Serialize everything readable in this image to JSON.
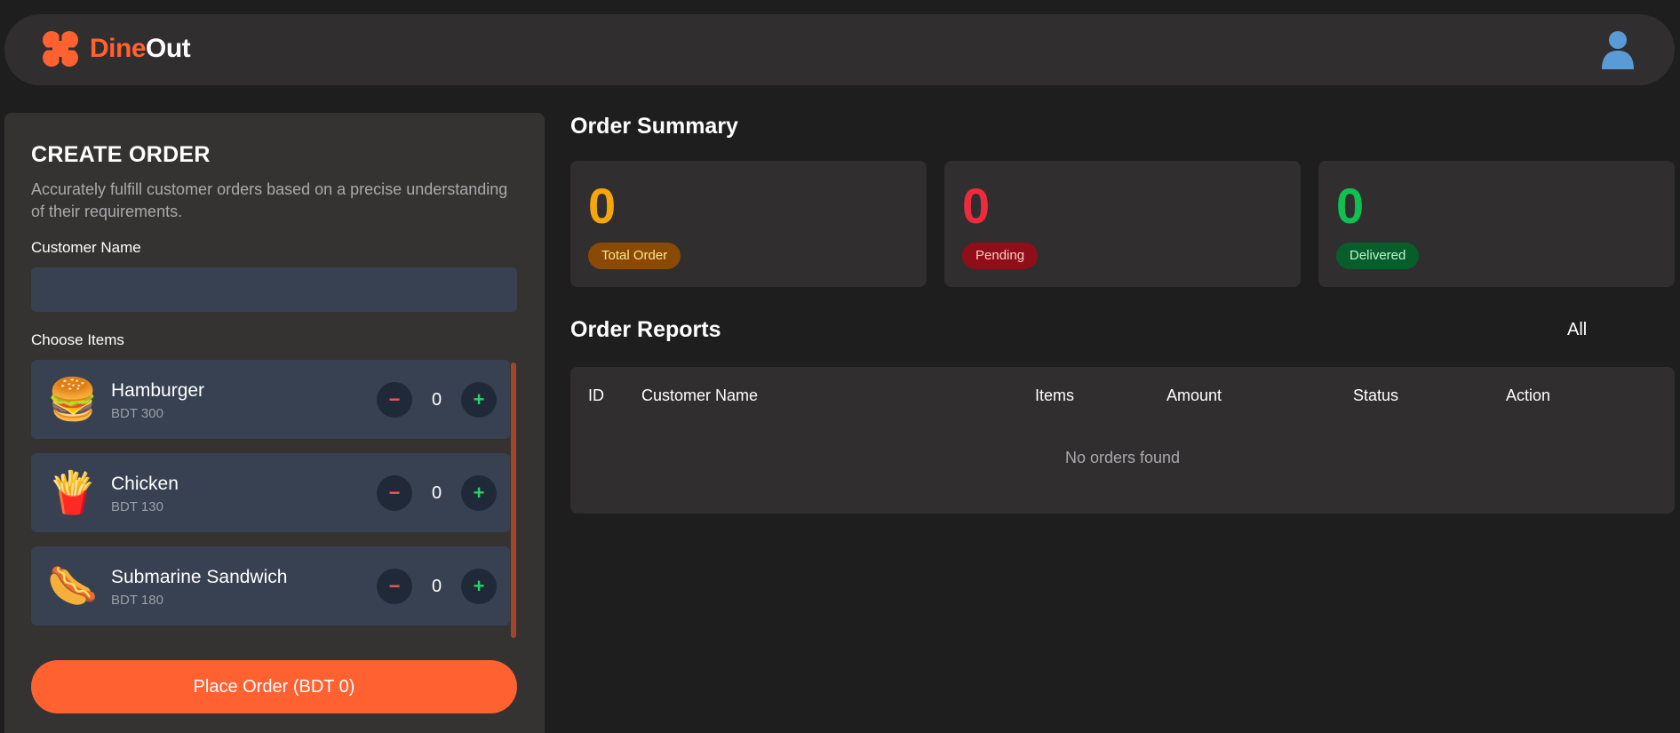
{
  "header": {
    "brand_part1": "Dine",
    "brand_part2": "Out",
    "logo_icon": "flower-icon",
    "avatar_icon": "user-icon"
  },
  "create_order": {
    "title": "CREATE ORDER",
    "description": "Accurately fulfill customer orders based on a precise understanding of their requirements.",
    "customer_name_label": "Customer Name",
    "customer_name_value": "",
    "choose_items_label": "Choose Items",
    "items": [
      {
        "name": "Hamburger",
        "price": "BDT 300",
        "qty": "0",
        "emoji": "🍔"
      },
      {
        "name": "Chicken",
        "price": "BDT 130",
        "qty": "0",
        "emoji": "🍟"
      },
      {
        "name": "Submarine Sandwich",
        "price": "BDT 180",
        "qty": "0",
        "emoji": "🌭"
      }
    ],
    "minus_symbol": "−",
    "plus_symbol": "+",
    "place_order_label": "Place Order (BDT 0)"
  },
  "summary": {
    "title": "Order Summary",
    "stats": [
      {
        "value": "0",
        "label": "Total Order",
        "num_color": "#f5a60c",
        "badge_bg": "#8a4a06",
        "badge_color": "#fde68a"
      },
      {
        "value": "0",
        "label": "Pending",
        "num_color": "#ee2b3c",
        "badge_bg": "#8f0e18",
        "badge_color": "#fecaca"
      },
      {
        "value": "0",
        "label": "Delivered",
        "num_color": "#12c050",
        "badge_bg": "#085e2a",
        "badge_color": "#bbf7d0"
      }
    ]
  },
  "reports": {
    "title": "Order Reports",
    "filter_label": "All",
    "columns": [
      "ID",
      "Customer Name",
      "Items",
      "Amount",
      "Status",
      "Action"
    ],
    "empty_message": "No orders found"
  },
  "colors": {
    "accent": "#ff6130",
    "background": "#1e1e1e",
    "panel": "#353232",
    "card": "#302e2e",
    "item_card": "#374151"
  }
}
